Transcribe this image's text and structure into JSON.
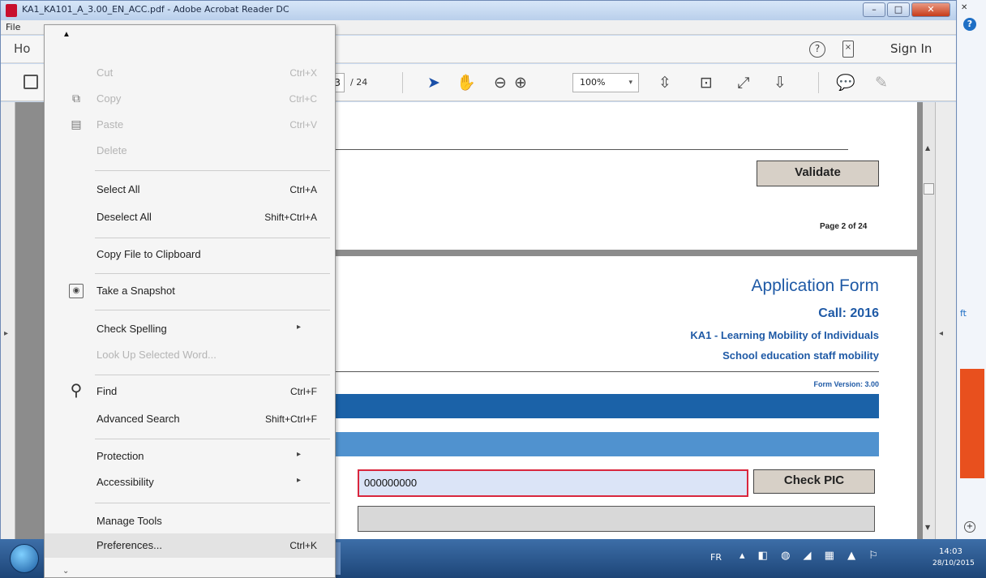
{
  "window": {
    "title": "KA1_KA101_A_3.00_EN_ACC.pdf - Adobe Acrobat Reader DC",
    "min_label": "–",
    "max_label": "□",
    "close_label": "✕"
  },
  "menubar": {
    "file": "File"
  },
  "topbar": {
    "home_tab": "Ho",
    "help_icon": "?",
    "mobile_icon": "×",
    "sign_in": "Sign In"
  },
  "toolbar": {
    "page_current": "3",
    "page_total": "/ 24",
    "zoom_value": "100%",
    "zoom_caret": "▾",
    "icons": {
      "select": "➤",
      "hand": "✋",
      "zoom_out": "⊖",
      "zoom_in": "⊕",
      "fit": "⇳",
      "page": "⊡",
      "fullscreen": "⤢",
      "read": "⇩",
      "comment": "💬",
      "sign": "✎"
    }
  },
  "edit_menu": {
    "items": [
      {
        "label": "Cut",
        "shortcut": "Ctrl+X",
        "disabled": true
      },
      {
        "label": "Copy",
        "shortcut": "Ctrl+C",
        "disabled": true
      },
      {
        "label": "Paste",
        "shortcut": "Ctrl+V",
        "disabled": true
      },
      {
        "label": "Delete",
        "shortcut": "",
        "disabled": true
      },
      {
        "label": "Select All",
        "shortcut": "Ctrl+A"
      },
      {
        "label": "Deselect All",
        "shortcut": "Shift+Ctrl+A"
      },
      {
        "label": "Copy File to Clipboard",
        "shortcut": ""
      },
      {
        "label": "Take a Snapshot",
        "shortcut": ""
      },
      {
        "label": "Check Spelling",
        "shortcut": "",
        "submenu": "▸"
      },
      {
        "label": "Look Up Selected Word...",
        "shortcut": "",
        "disabled": true
      },
      {
        "label": "Find",
        "shortcut": "Ctrl+F"
      },
      {
        "label": "Advanced Search",
        "shortcut": "Shift+Ctrl+F"
      },
      {
        "label": "Protection",
        "shortcut": "",
        "submenu": "▸"
      },
      {
        "label": "Accessibility",
        "shortcut": "",
        "submenu": "▸"
      },
      {
        "label": "Manage Tools",
        "shortcut": ""
      },
      {
        "label": "Preferences...",
        "shortcut": "Ctrl+K",
        "highlighted": true
      }
    ],
    "up_arrow": "▲",
    "down_arrow": "⌄"
  },
  "document": {
    "page1": {
      "validate_button": "Validate",
      "page_number": "Page 2 of 24"
    },
    "page2": {
      "title": "Application Form",
      "call": "Call: 2016",
      "action": "KA1 - Learning Mobility of Individuals",
      "subtitle": "School education staff mobility",
      "form_version": "Form Version: 3.00",
      "pic_value": "000000000",
      "check_pic_button": "Check PIC"
    }
  },
  "taskbar": {
    "lang": "FR",
    "tray_icons": "▴ ◧ ◍ ◢ ▦ ▲ ⚐",
    "time": "14:03",
    "date": "28/10/2015"
  },
  "right_strip": {
    "close": "✕",
    "help": "?",
    "plus": "+",
    "arrow": "ft"
  },
  "colors": {
    "accent_blue": "#1f5aa6",
    "band_dark": "#1b62a8",
    "band_light": "#5092cf",
    "field_border": "#d9263d"
  }
}
